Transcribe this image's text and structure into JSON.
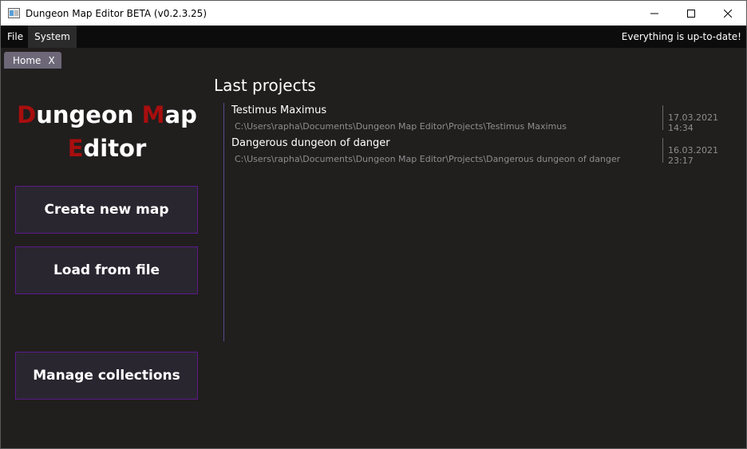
{
  "window": {
    "title": "Dungeon Map Editor BETA (v0.2.3.25)",
    "controls": {
      "minimize_icon": "minimize-icon",
      "maximize_icon": "maximize-icon",
      "close_icon": "close-icon"
    }
  },
  "menubar": {
    "items": [
      {
        "label": "File"
      },
      {
        "label": "System"
      }
    ],
    "status": "Everything is up-to-date!"
  },
  "tabs": [
    {
      "label": "Home",
      "close_label": "X"
    }
  ],
  "logo": {
    "words": [
      {
        "initial": "D",
        "rest": "ungeon"
      },
      {
        "initial": "M",
        "rest": "ap"
      },
      {
        "initial": "E",
        "rest": "ditor"
      }
    ],
    "initial_color": "#a80e0e"
  },
  "actions": {
    "create_label": "Create new map",
    "load_label": "Load from file",
    "manage_label": "Manage collections"
  },
  "recent": {
    "title": "Last projects",
    "projects": [
      {
        "name": "Testimus Maximus",
        "path": "C:\\Users\\rapha\\Documents\\Dungeon Map Editor\\Projects\\Testimus Maximus",
        "date": "17.03.2021 14:34"
      },
      {
        "name": "Dangerous dungeon of danger",
        "path": "C:\\Users\\rapha\\Documents\\Dungeon Map Editor\\Projects\\Dangerous dungeon of danger",
        "date": "16.03.2021 23:17"
      }
    ]
  },
  "colors": {
    "background": "#211e1e",
    "button_border": "#5a1a8a",
    "accent_red": "#a80e0e"
  }
}
